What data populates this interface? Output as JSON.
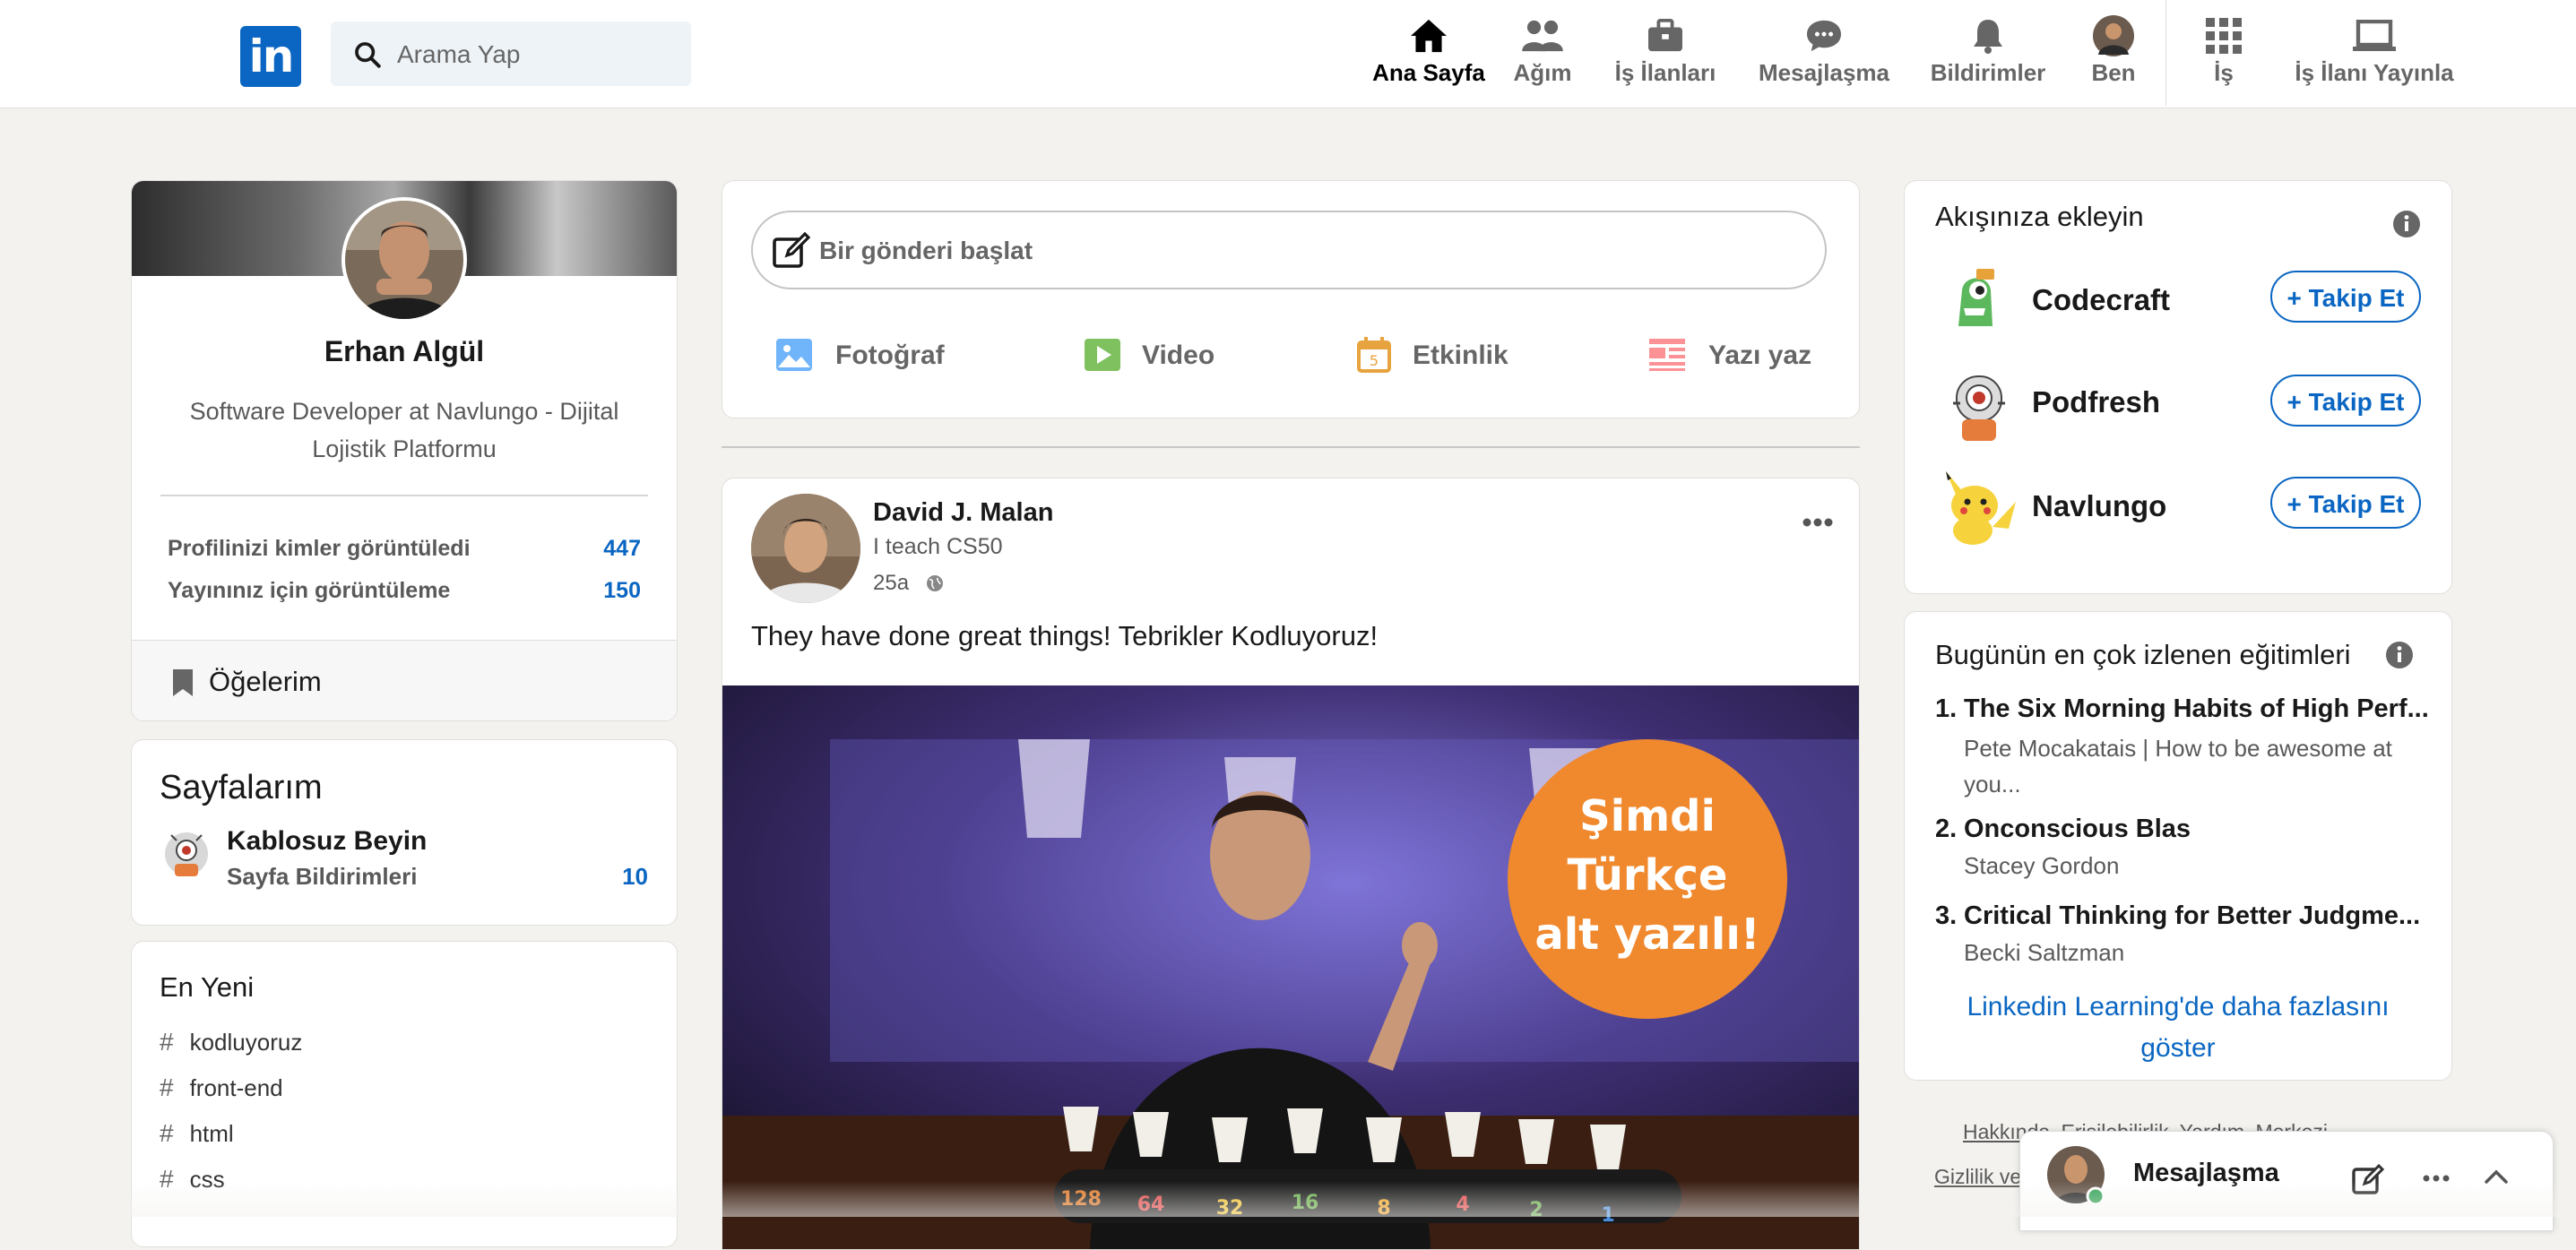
{
  "colors": {
    "brand": "#0a66c2",
    "page_bg": "#f3f2ef",
    "accent_orange": "#f0892e"
  },
  "nav": {
    "logo": "in",
    "search_placeholder": "Arama Yap",
    "items": [
      {
        "label": "Ana Sayfa",
        "icon": "home-icon"
      },
      {
        "label": "Ağım",
        "icon": "network-icon"
      },
      {
        "label": "İş İlanları",
        "icon": "briefcase-icon"
      },
      {
        "label": "Mesajlaşma",
        "icon": "messaging-icon"
      },
      {
        "label": "Bildirimler",
        "icon": "bell-icon"
      },
      {
        "label": "Ben",
        "icon": "avatar"
      },
      {
        "label": "İş",
        "icon": "grid-icon"
      },
      {
        "label": "İş İlanı Yayınla",
        "icon": "laptop-icon"
      }
    ]
  },
  "profile": {
    "name": "Erhan Algül",
    "headline": "Software Developer at Navlungo - Dijital Lojistik Platformu",
    "stats": [
      {
        "label": "Profilinizi kimler görüntüledi",
        "value": "447"
      },
      {
        "label": "Yayınınız için görüntüleme",
        "value": "150"
      }
    ],
    "items_label": "Öğelerim"
  },
  "pages": {
    "title": "Sayfalarım",
    "page_name": "Kablosuz Beyin",
    "sub": "Sayfa Bildirimleri",
    "count": "10"
  },
  "recent": {
    "title": "En Yeni",
    "tags": [
      "kodluyoruz",
      "front-end",
      "html",
      "css"
    ]
  },
  "composer": {
    "placeholder": "Bir gönderi başlat",
    "actions": [
      "Fotoğraf",
      "Video",
      "Etkinlik",
      "Yazı yaz"
    ]
  },
  "post": {
    "author": "David J. Malan",
    "subtitle": "I teach CS50",
    "time": "25a",
    "text": "They have done great things! Tebrikler Kodluyoruz!",
    "badge_lines": [
      "Şimdi",
      "Türkçe",
      "alt yazılı!"
    ],
    "bulb_numbers": [
      "128",
      "64",
      "32",
      "16",
      "8",
      "4",
      "2",
      "1"
    ]
  },
  "feed_suggest": {
    "title": "Akışınıza ekleyin",
    "follow_label": "+ Takip Et",
    "items": [
      {
        "name": "Codecraft"
      },
      {
        "name": "Podfresh"
      },
      {
        "name": "Navlungo"
      }
    ]
  },
  "learning": {
    "title": "Bugünün en çok izlenen eğitimleri",
    "courses": [
      {
        "num": "1.",
        "title": "The Six Morning Habits of High Perf...",
        "author": "Pete Mocakatais | How to be awesome at you..."
      },
      {
        "num": "2.",
        "title": "Onconscious Blas",
        "author": "Stacey Gordon"
      },
      {
        "num": "3.",
        "title": "Critical Thinking for Better Judgme...",
        "author": "Becki Saltzman"
      }
    ],
    "more_link": "Linkedin Learning'de daha fazlasını göster"
  },
  "footer": {
    "line1": "Hakkında  Erişilebilirlik  Yardım Merkezi",
    "line2": "Gizlilik ve"
  },
  "messaging": {
    "label": "Mesajlaşma"
  }
}
